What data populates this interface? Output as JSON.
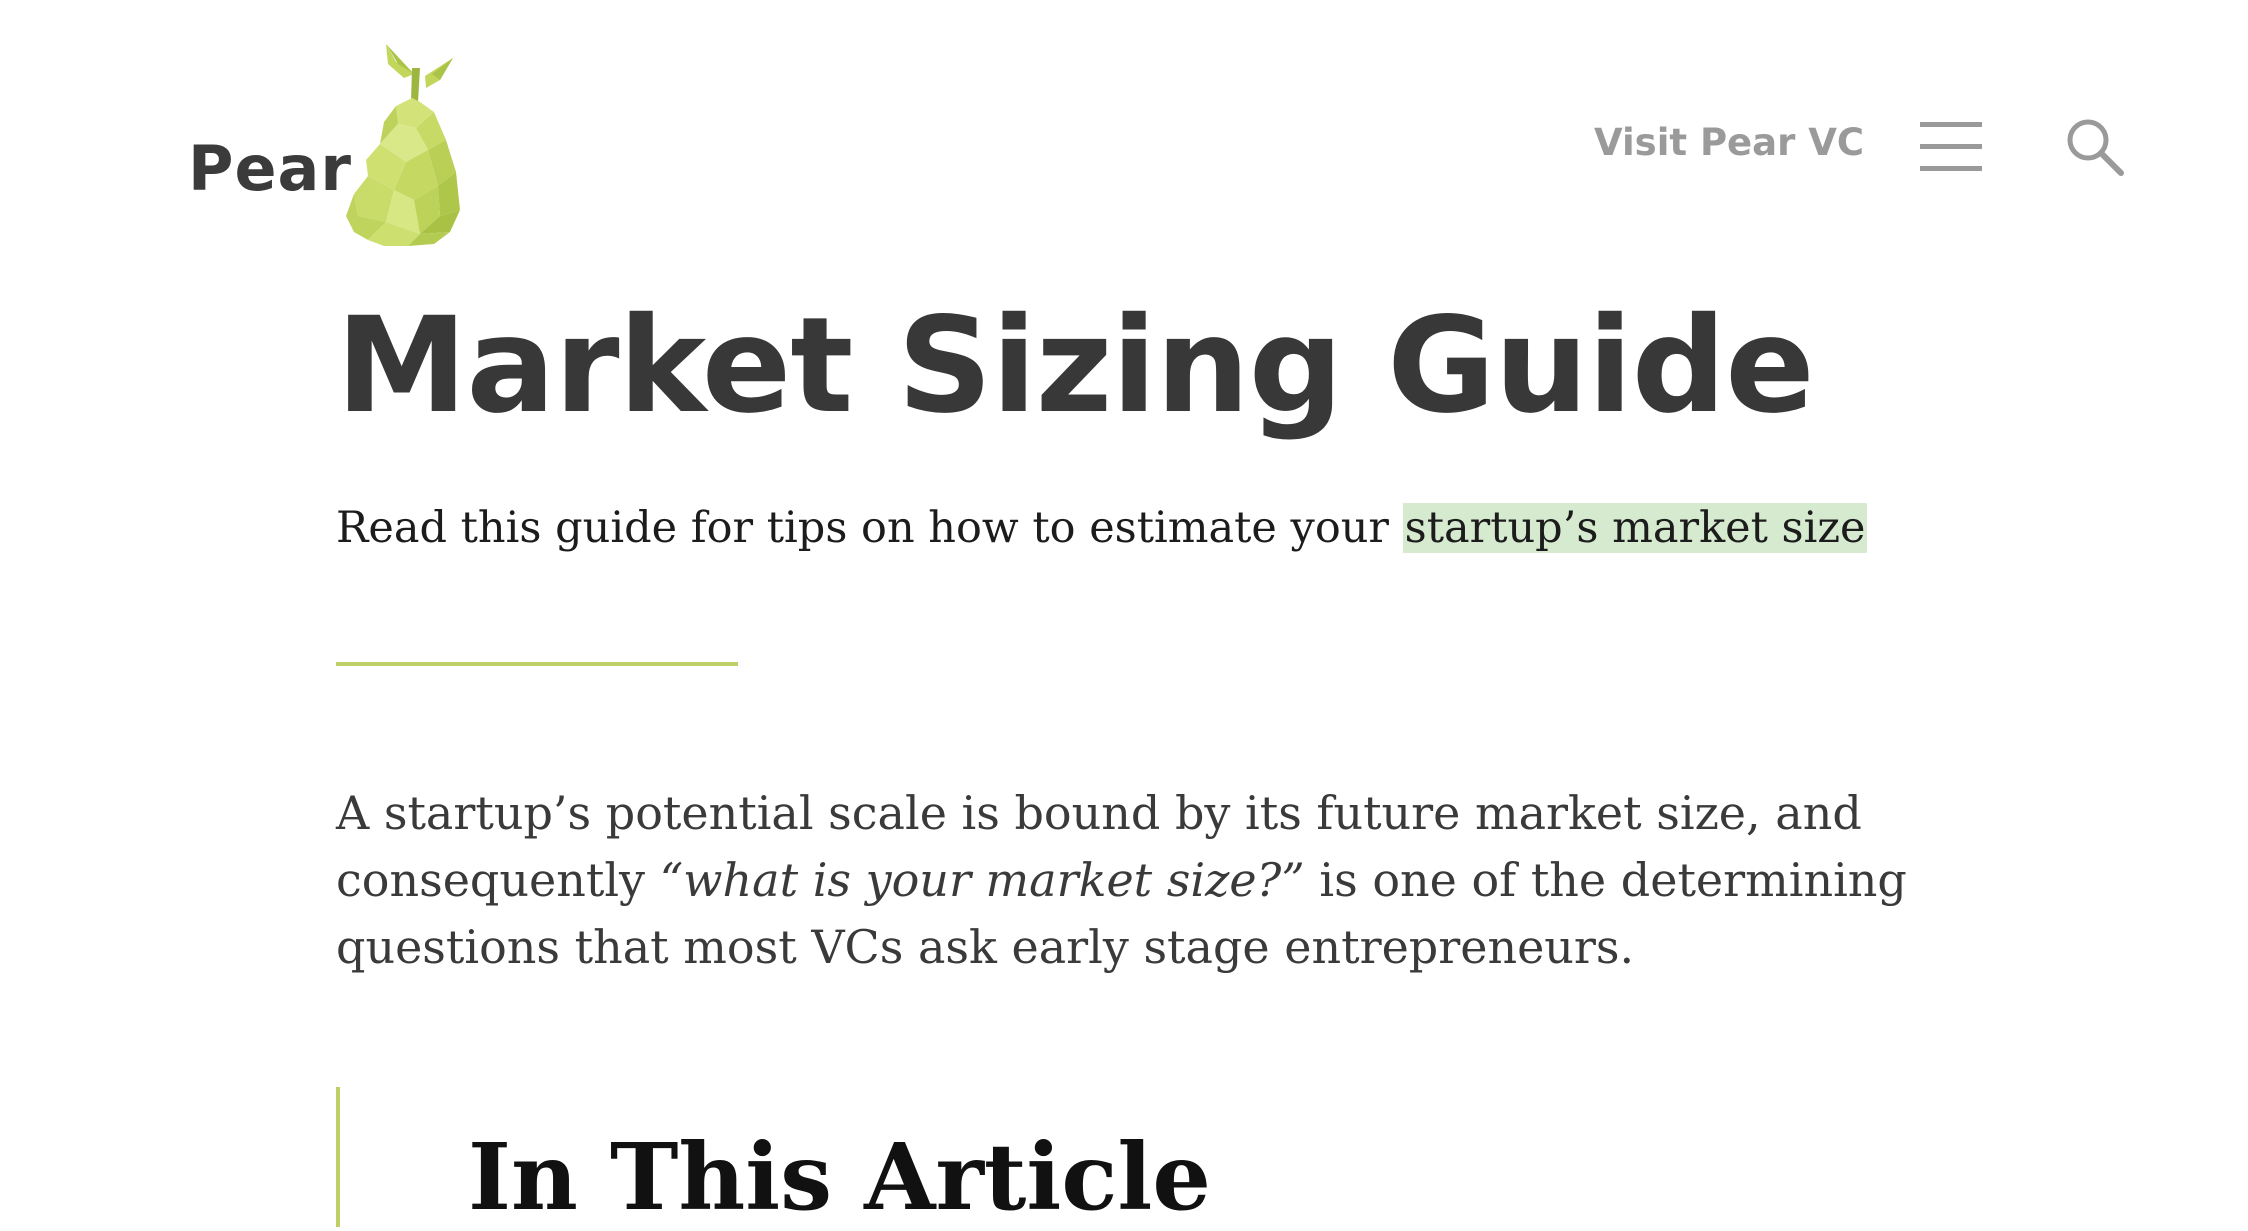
{
  "header": {
    "logo_text": "Pear",
    "visit_link": "Visit Pear VC",
    "menu_icon": "hamburger-menu-icon",
    "search_icon": "magnifier-search-icon"
  },
  "hero": {
    "title": "Market Sizing Guide",
    "subtitle_prefix": "Read this guide for tips on how to estimate your ",
    "subtitle_highlight": "startup’s market size"
  },
  "intro": {
    "text_before": "A startup’s potential scale is bound by its future market size, and consequently ",
    "quote": "“what is your market size?”",
    "text_after": " is one of the determining questions that most VCs ask early stage entrepreneurs."
  },
  "toc": {
    "heading": "In This Article"
  },
  "colors": {
    "brand_green": "#c5d960",
    "accent_line": "#bfcf66",
    "highlight": "#d6ead0",
    "text_dark": "#383838",
    "nav_grey": "#9a9a9a"
  }
}
